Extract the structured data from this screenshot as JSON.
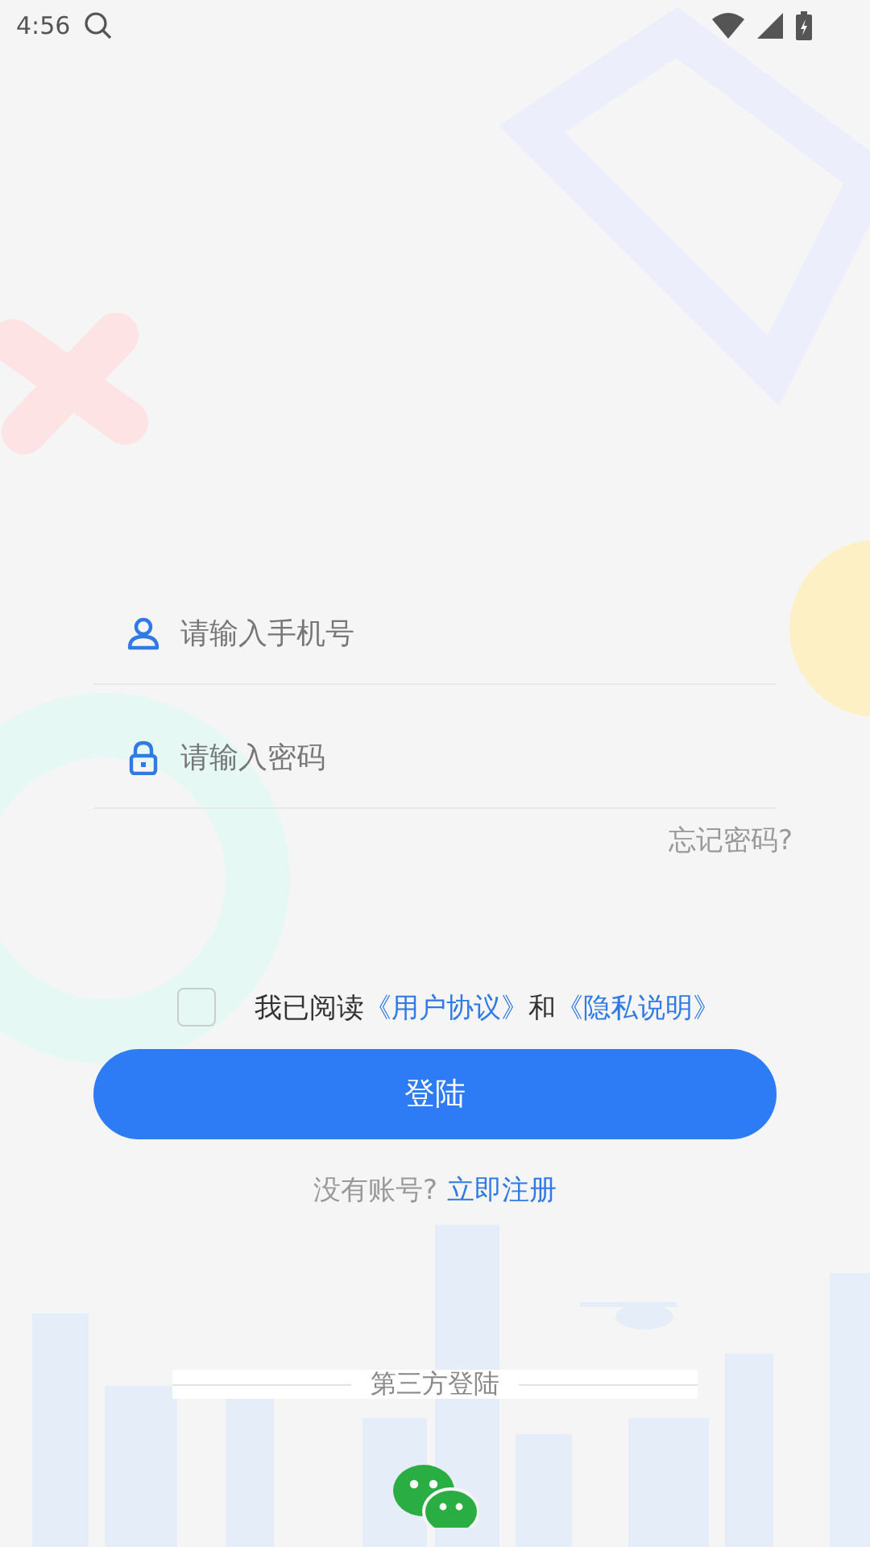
{
  "status_bar": {
    "time": "4:56"
  },
  "phone_field": {
    "placeholder": "请输入手机号"
  },
  "password_field": {
    "placeholder": "请输入密码"
  },
  "forgot_password": "忘记密码?",
  "agreement": {
    "checked": false,
    "prefix": "我已阅读",
    "links": [
      "《用户协议》",
      "《隐私说明》"
    ],
    "conjunction": "和"
  },
  "login_button": "登陆",
  "register": {
    "prompt": "没有账号?",
    "link": "立即注册"
  },
  "third_party": {
    "title": "第三方登陆"
  }
}
